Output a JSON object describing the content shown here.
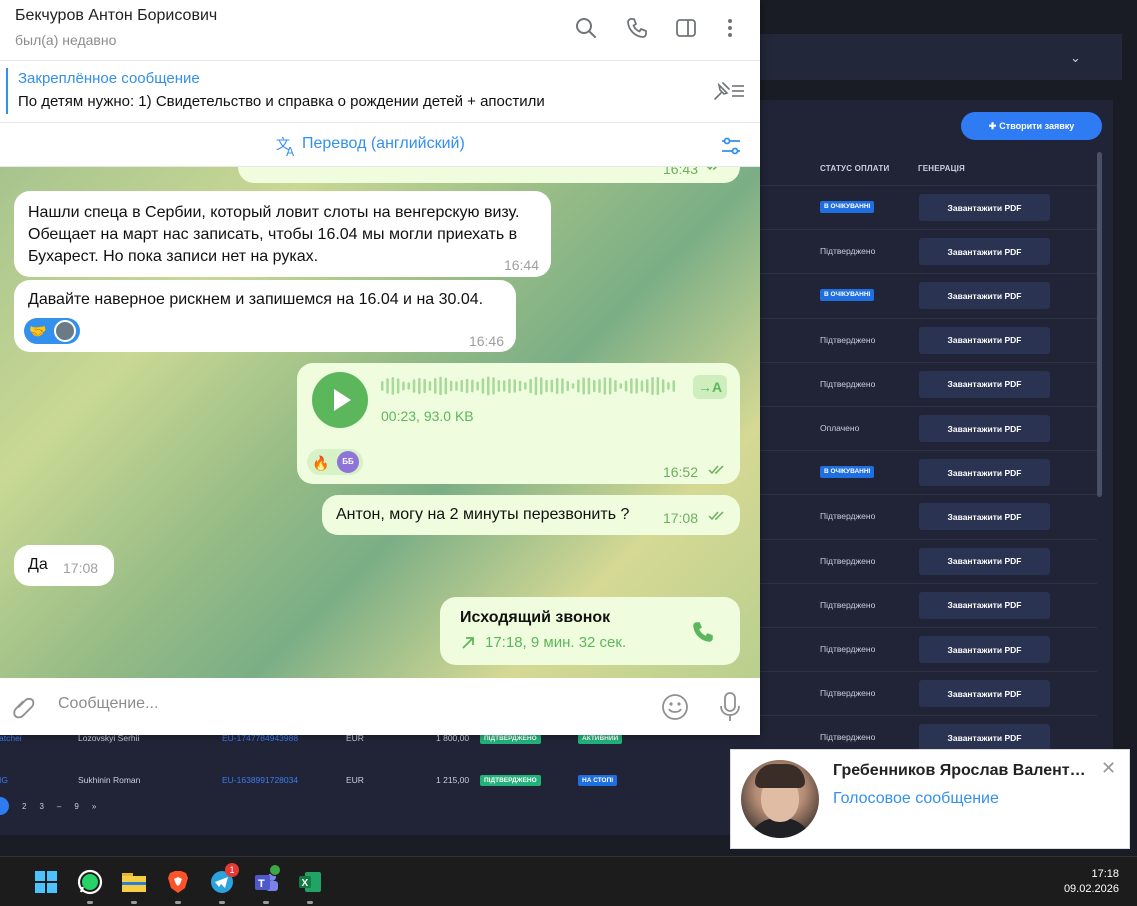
{
  "background_app": {
    "create_button_label": "Створити заявку",
    "columns": {
      "payment_status": "СТАТУС ОПЛАТИ",
      "generation": "ГЕНЕРАЦІЯ"
    },
    "rows": [
      {
        "status": "В ОЧІКУВАННІ",
        "status_type": "badge",
        "pdf_label": "Завантажити PDF"
      },
      {
        "status": "Підтверджено",
        "status_type": "text",
        "pdf_label": "Завантажити PDF"
      },
      {
        "status": "В ОЧІКУВАННІ",
        "status_type": "badge",
        "pdf_label": "Завантажити PDF"
      },
      {
        "status": "Підтверджено",
        "status_type": "text",
        "pdf_label": "Завантажити PDF"
      },
      {
        "status": "Підтверджено",
        "status_type": "text",
        "pdf_label": "Завантажити PDF"
      },
      {
        "status": "Оплачено",
        "status_type": "text",
        "pdf_label": "Завантажити PDF"
      },
      {
        "status": "В ОЧІКУВАННІ",
        "status_type": "badge",
        "pdf_label": "Завантажити PDF"
      },
      {
        "status": "Підтверджено",
        "status_type": "text",
        "pdf_label": "Завантажити PDF"
      },
      {
        "status": "Підтверджено",
        "status_type": "text",
        "pdf_label": "Завантажити PDF"
      },
      {
        "status": "Підтверджено",
        "status_type": "text",
        "pdf_label": "Завантажити PDF"
      },
      {
        "status": "Підтверджено",
        "status_type": "text",
        "pdf_label": "Завантажити PDF"
      },
      {
        "status": "Підтверджено",
        "status_type": "text",
        "pdf_label": "Завантажити PDF"
      },
      {
        "status": "Підтверджено",
        "status_type": "text",
        "pdf_label": "Завантажити PDF"
      }
    ],
    "bottom_rows": [
      {
        "id": "atchei",
        "name": "Lozovskyi Serhii",
        "ref": "EU-1747784943988",
        "currency": "EUR",
        "amount": "1 800,00",
        "status": "ПІДТВЕРДЖЕНО",
        "state": "АКТИВНИЙ"
      },
      {
        "id": "IG",
        "name": "Sukhinin Roman",
        "ref": "EU-1638991728034",
        "currency": "EUR",
        "amount": "1 215,00",
        "status": "ПІДТВЕРДЖЕНО",
        "state": "НА СТОПІ"
      }
    ],
    "pagination": {
      "p2": "2",
      "p3": "3",
      "dash": "–",
      "p9": "9",
      "next": "»"
    }
  },
  "telegram": {
    "contact_name": "Бекчуров Антон Борисович",
    "contact_status": "был(а) недавно",
    "pinned": {
      "title": "Закреплённое сообщение",
      "text": "По детям нужно:  1) Свидетельство и справка о рождении детей + апостили"
    },
    "translate_label": "Перевод (английский)",
    "partial_message_time": "16:43",
    "messages": [
      {
        "text": "Нашли спеца в Сербии, который ловит слоты на венгерскую визу. Обещает на март нас записать, чтобы 16.04 мы могли приехать в Бухарест. Но пока записи нет на руках.",
        "time": "16:44"
      },
      {
        "text": "Давайте наверное рискнем и запишемся на 16.04 и на 30.04.",
        "time": "16:46",
        "reaction": "🤝"
      },
      {
        "voice_meta": "00:23, 93.0 KB",
        "time": "16:52",
        "reaction": "🔥",
        "reactor_initials": "ББ"
      },
      {
        "text": "Антон, могу на 2 минуты перезвонить ?",
        "time": "17:08"
      },
      {
        "text": "Да",
        "time": "17:08"
      },
      {
        "call_title": "Исходящий звонок",
        "call_meta": "17:18, 9 мин. 32 сек."
      }
    ],
    "composer_placeholder": "Сообщение..."
  },
  "notification": {
    "name": "Гребенников Ярослав Валент…",
    "subtitle": "Голосовое сообщение"
  },
  "taskbar": {
    "time": "17:18",
    "date": "09.02.2026",
    "telegram_badge": "1"
  }
}
